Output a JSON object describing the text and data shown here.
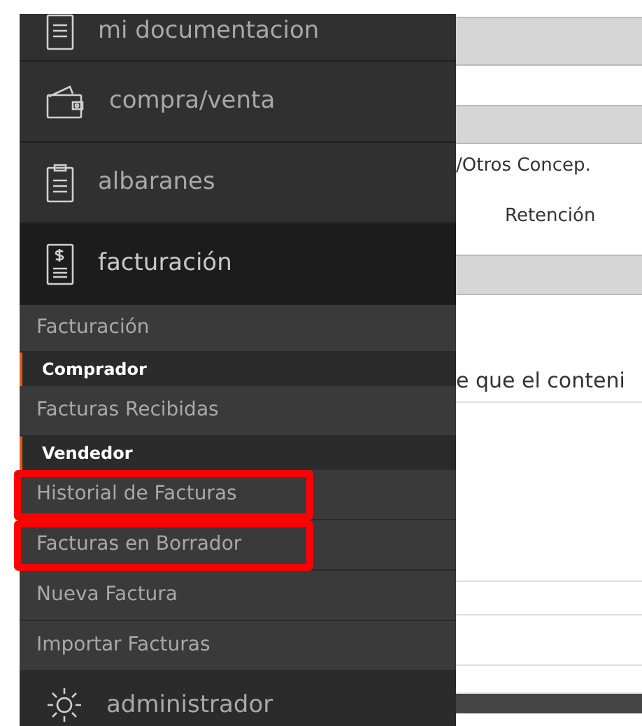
{
  "sidebar": {
    "items": [
      {
        "label": "mi documentacion",
        "active": false
      },
      {
        "label": "compra/venta",
        "active": false
      },
      {
        "label": "albaranes",
        "active": false
      },
      {
        "label": "facturación",
        "active": true
      }
    ],
    "submenu": {
      "title": "Facturación",
      "entries": [
        {
          "kind": "section",
          "label": "Comprador"
        },
        {
          "kind": "link",
          "label": "Facturas Recibidas",
          "highlighted": false
        },
        {
          "kind": "section",
          "label": "Vendedor"
        },
        {
          "kind": "link",
          "label": "Historial de Facturas",
          "highlighted": true
        },
        {
          "kind": "link",
          "label": "Facturas en Borrador",
          "highlighted": true
        },
        {
          "kind": "link",
          "label": "Nueva Factura",
          "highlighted": false
        },
        {
          "kind": "link",
          "label": "Importar Facturas",
          "highlighted": false
        }
      ]
    },
    "bottom_item": {
      "label": "administrador"
    }
  },
  "content": {
    "texts": [
      "/Otros Concep.",
      "Retención",
      "e que el conteni"
    ]
  }
}
